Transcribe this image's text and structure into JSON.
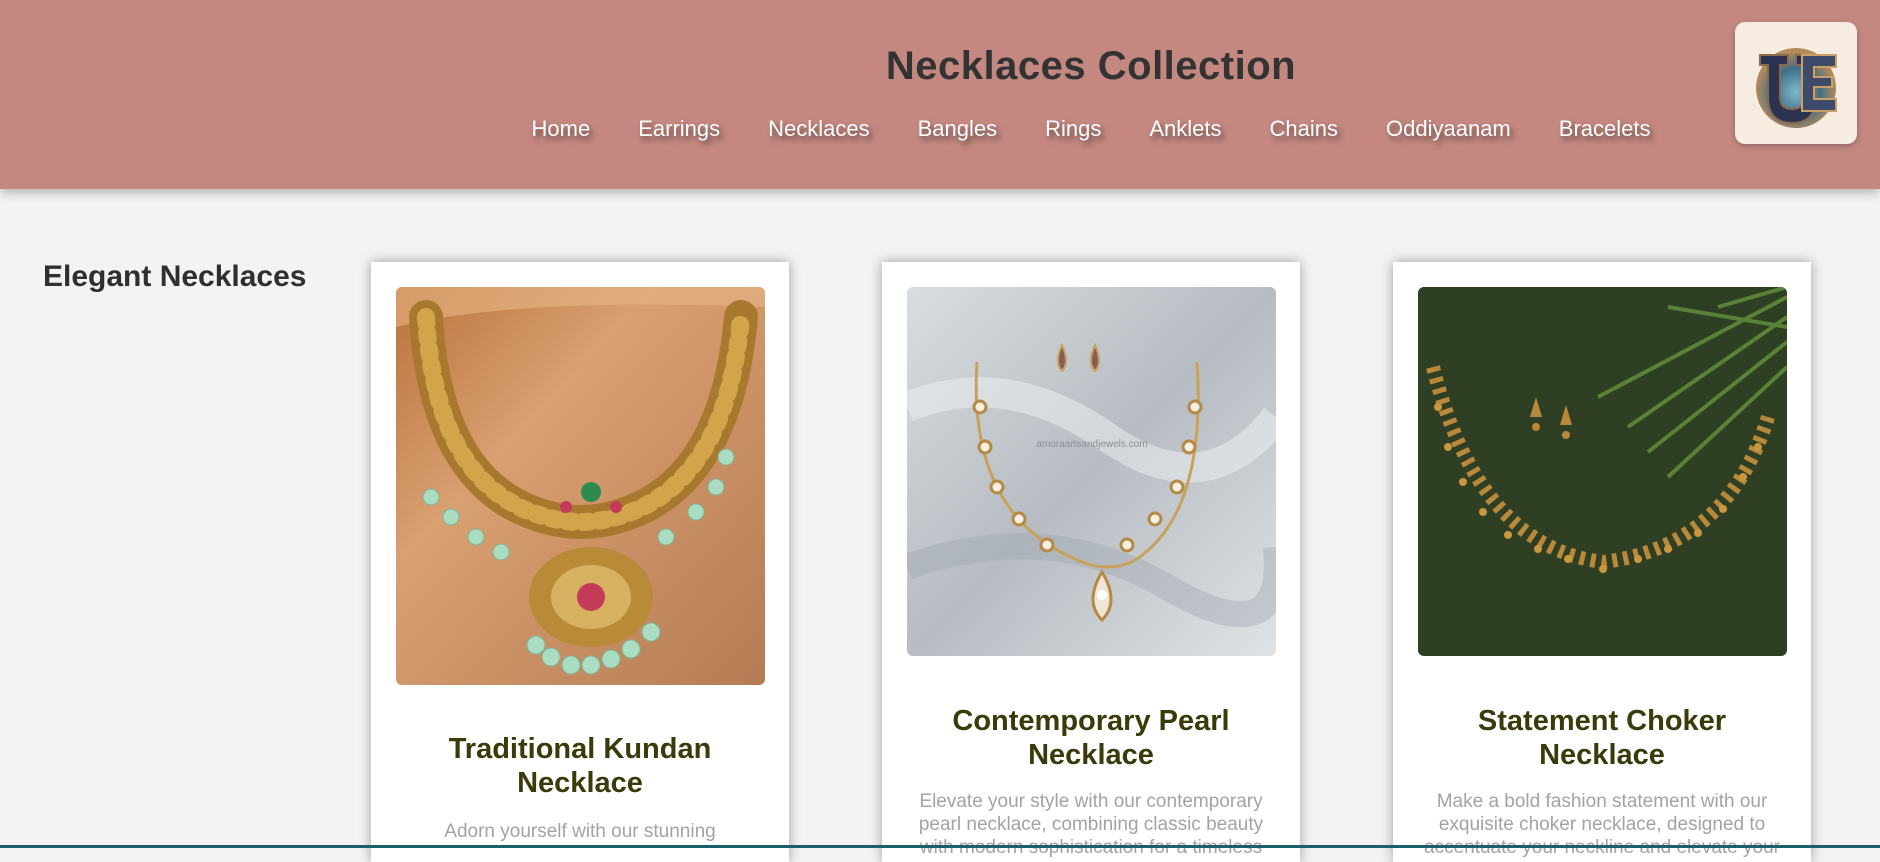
{
  "header": {
    "title": "Necklaces Collection",
    "nav": [
      "Home",
      "Earrings",
      "Necklaces",
      "Bangles",
      "Rings",
      "Anklets",
      "Chains",
      "Oddiyaanam",
      "Bracelets"
    ],
    "background_color": "#c48880"
  },
  "logo": {
    "icon": "logo-icon",
    "alt": "UE"
  },
  "main": {
    "section_title": "Elegant Necklaces",
    "products": [
      {
        "title": "Traditional Kundan Necklace",
        "description": "Adorn yourself with our stunning",
        "image_icon": "kundan-necklace-image"
      },
      {
        "title": "Contemporary Pearl Necklace",
        "description": "Elevate your style with our contemporary pearl necklace, combining classic beauty with modern sophistication for a timeless",
        "image_icon": "pearl-necklace-image",
        "watermark": "amoraartsandjewels.com"
      },
      {
        "title": "Statement Choker Necklace",
        "description": "Make a bold fashion statement with our exquisite choker necklace, designed to accentuate your neckline and elevate your",
        "image_icon": "choker-necklace-image"
      }
    ]
  }
}
